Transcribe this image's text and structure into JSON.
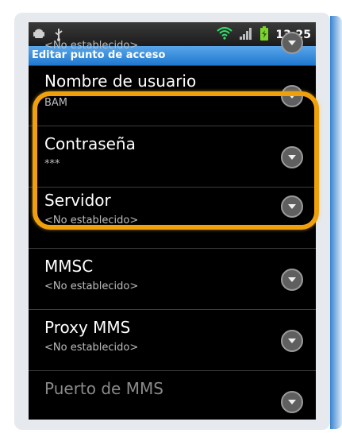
{
  "status_bar": {
    "time": "13:25",
    "icons": [
      "android-debug-icon",
      "usb-icon",
      "wifi-icon",
      "signal-icon",
      "battery-icon"
    ]
  },
  "title_bar": {
    "title": "Editar punto de acceso"
  },
  "settings": [
    {
      "title": "",
      "value": "<No establecido>"
    },
    {
      "title": "Nombre de usuario",
      "value": "BAM"
    },
    {
      "title": "Contraseña",
      "value": "***"
    },
    {
      "title": "Servidor",
      "value": "<No establecido>"
    },
    {
      "title": "MMSC",
      "value": "<No establecido>"
    },
    {
      "title": "Proxy MMS",
      "value": "<No establecido>"
    },
    {
      "title": "Puerto de MMS",
      "value": ""
    }
  ],
  "colors": {
    "highlight": "#f1a00d",
    "title_bar": "#2a82d6",
    "background": "#000000"
  }
}
